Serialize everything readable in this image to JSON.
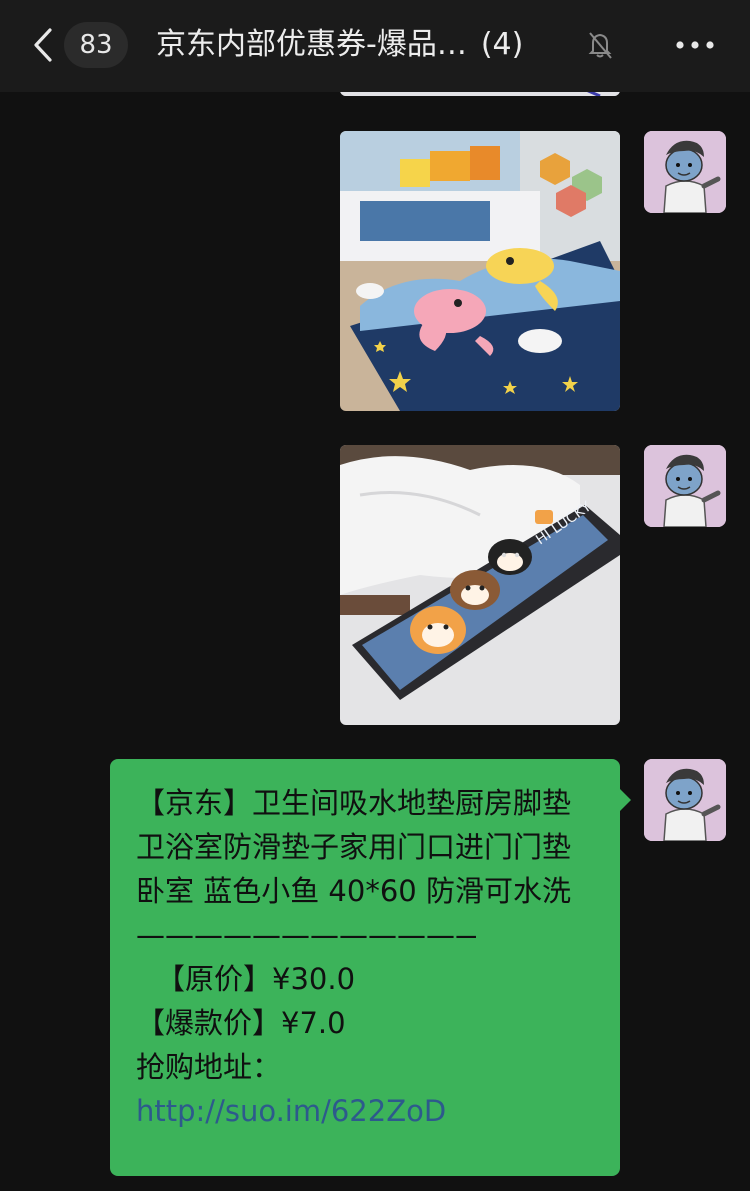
{
  "header": {
    "back_icon": "chevron-left-icon",
    "unread_count": "83",
    "title": "京东内部优惠券-爆品…",
    "member_count": "(4)",
    "mute_icon": "bell-muted-icon",
    "more_icon": "more-dots-icon"
  },
  "messages": [
    {
      "type": "image",
      "description_icon": "rug-dolphin-photo",
      "sender": "self"
    },
    {
      "type": "image",
      "description_icon": "rug-shiba-photo",
      "sender": "self"
    },
    {
      "type": "text",
      "sender": "self",
      "body": "【京东】卫生间吸水地垫厨房脚垫卫浴室防滑垫子家用门口进门门垫卧室 蓝色小鱼 40*60 防滑可水洗",
      "divider": "——————————————",
      "original_price": "【原价】¥30.0",
      "sale_price": "【爆款价】¥7.0",
      "buy_label": "抢购地址：",
      "link": "http://suo.im/622ZoD"
    }
  ],
  "colors": {
    "background": "#111111",
    "header": "#1b1b1b",
    "bubble": "#3cb35a",
    "link": "#2d5a8c"
  }
}
